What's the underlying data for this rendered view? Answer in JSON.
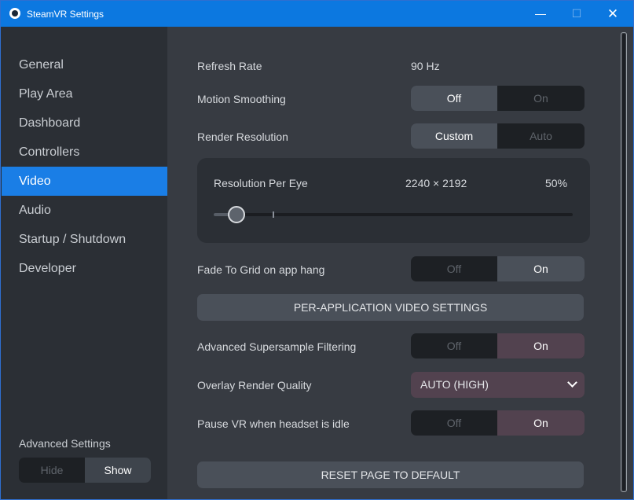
{
  "window": {
    "title": "SteamVR Settings",
    "minimize_glyph": "—",
    "maximize_glyph": "☐",
    "close_glyph": "✕"
  },
  "sidebar": {
    "items": [
      {
        "label": "General",
        "active": false
      },
      {
        "label": "Play Area",
        "active": false
      },
      {
        "label": "Dashboard",
        "active": false
      },
      {
        "label": "Controllers",
        "active": false
      },
      {
        "label": "Video",
        "active": true
      },
      {
        "label": "Audio",
        "active": false
      },
      {
        "label": "Startup / Shutdown",
        "active": false
      },
      {
        "label": "Developer",
        "active": false
      }
    ],
    "advanced": {
      "label": "Advanced Settings",
      "off_label": "Hide",
      "on_label": "Show",
      "selected": "Show"
    }
  },
  "video": {
    "refresh_rate": {
      "label": "Refresh Rate",
      "value": "90 Hz"
    },
    "motion_smoothing": {
      "label": "Motion Smoothing",
      "left": "Off",
      "right": "On",
      "selected": "Off"
    },
    "render_resolution": {
      "label": "Render Resolution",
      "left": "Custom",
      "right": "Auto",
      "selected": "Custom"
    },
    "resolution_per_eye": {
      "label": "Resolution Per Eye",
      "value": "2240 × 2192",
      "percent_label": "50%",
      "percent": 50,
      "slider_min": 20,
      "slider_max": 500,
      "default_mark": 100
    },
    "fade_to_grid": {
      "label": "Fade To Grid on app hang",
      "left": "Off",
      "right": "On",
      "selected": "On"
    },
    "per_app_button": "PER-APPLICATION VIDEO SETTINGS",
    "advanced_supersample": {
      "label": "Advanced Supersample Filtering",
      "left": "Off",
      "right": "On",
      "selected": "On"
    },
    "overlay_quality": {
      "label": "Overlay Render Quality",
      "value": "AUTO (HIGH)"
    },
    "pause_vr": {
      "label": "Pause VR when headset is idle",
      "left": "Off",
      "right": "On",
      "selected": "On"
    },
    "reset_button": "RESET PAGE TO DEFAULT"
  },
  "colors": {
    "accent": "#1a7ee6",
    "titlebar": "#0c78e0",
    "toggle_on_purple": "#52424f"
  }
}
